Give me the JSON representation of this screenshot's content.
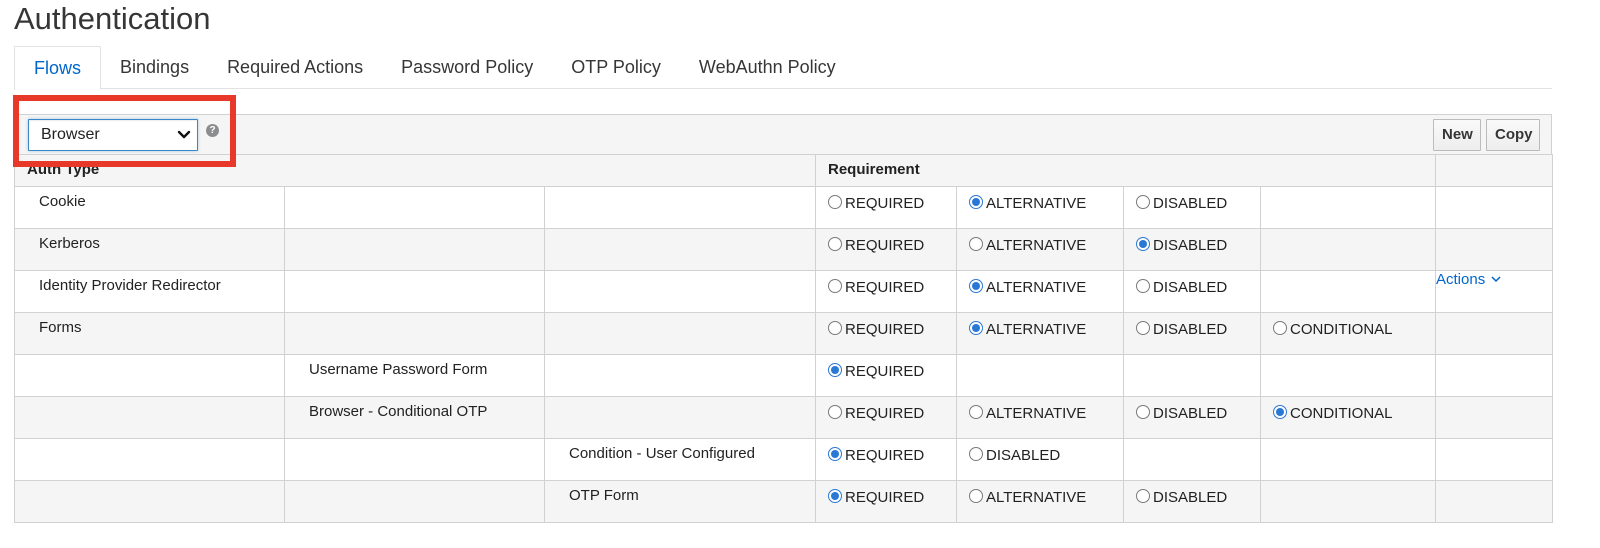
{
  "page": {
    "title": "Authentication"
  },
  "tabs": [
    {
      "label": "Flows",
      "active": true
    },
    {
      "label": "Bindings",
      "active": false
    },
    {
      "label": "Required Actions",
      "active": false
    },
    {
      "label": "Password Policy",
      "active": false
    },
    {
      "label": "OTP Policy",
      "active": false
    },
    {
      "label": "WebAuthn Policy",
      "active": false
    }
  ],
  "toolbar": {
    "flow_select_value": "Browser",
    "help_glyph": "?",
    "new_label": "New",
    "copy_label": "Copy"
  },
  "table": {
    "headers": {
      "auth_type": "Auth Type",
      "requirement": "Requirement"
    },
    "rows": [
      {
        "level": 0,
        "name": "Cookie",
        "options": [
          {
            "label": "REQUIRED",
            "selected": false
          },
          {
            "label": "ALTERNATIVE",
            "selected": true
          },
          {
            "label": "DISABLED",
            "selected": false
          }
        ],
        "actions": ""
      },
      {
        "level": 0,
        "name": "Kerberos",
        "options": [
          {
            "label": "REQUIRED",
            "selected": false
          },
          {
            "label": "ALTERNATIVE",
            "selected": false
          },
          {
            "label": "DISABLED",
            "selected": true
          }
        ],
        "actions": ""
      },
      {
        "level": 0,
        "name": "Identity Provider Redirector",
        "options": [
          {
            "label": "REQUIRED",
            "selected": false
          },
          {
            "label": "ALTERNATIVE",
            "selected": true
          },
          {
            "label": "DISABLED",
            "selected": false
          }
        ],
        "actions": "Actions"
      },
      {
        "level": 0,
        "name": "Forms",
        "options": [
          {
            "label": "REQUIRED",
            "selected": false
          },
          {
            "label": "ALTERNATIVE",
            "selected": true
          },
          {
            "label": "DISABLED",
            "selected": false
          },
          {
            "label": "CONDITIONAL",
            "selected": false
          }
        ],
        "actions": ""
      },
      {
        "level": 1,
        "name": "Username Password Form",
        "options": [
          {
            "label": "REQUIRED",
            "selected": true
          }
        ],
        "actions": ""
      },
      {
        "level": 1,
        "name": "Browser - Conditional OTP",
        "options": [
          {
            "label": "REQUIRED",
            "selected": false
          },
          {
            "label": "ALTERNATIVE",
            "selected": false
          },
          {
            "label": "DISABLED",
            "selected": false
          },
          {
            "label": "CONDITIONAL",
            "selected": true
          }
        ],
        "actions": ""
      },
      {
        "level": 2,
        "name": "Condition - User Configured",
        "options": [
          {
            "label": "REQUIRED",
            "selected": true
          },
          {
            "label": "DISABLED",
            "selected": false
          }
        ],
        "actions": ""
      },
      {
        "level": 2,
        "name": "OTP Form",
        "options": [
          {
            "label": "REQUIRED",
            "selected": true
          },
          {
            "label": "ALTERNATIVE",
            "selected": false
          },
          {
            "label": "DISABLED",
            "selected": false
          }
        ],
        "actions": ""
      }
    ]
  },
  "icons": {
    "select_chevron": "chevron-down-icon",
    "help": "help-icon",
    "actions_chevron": "chevron-down-icon",
    "radio": "radio-button"
  },
  "colors": {
    "accent": "#0066cc",
    "radio_selected": "#2a78d6",
    "highlight": "#e8382a",
    "row_alt": "#f5f5f5",
    "border": "#d1d1d1"
  }
}
